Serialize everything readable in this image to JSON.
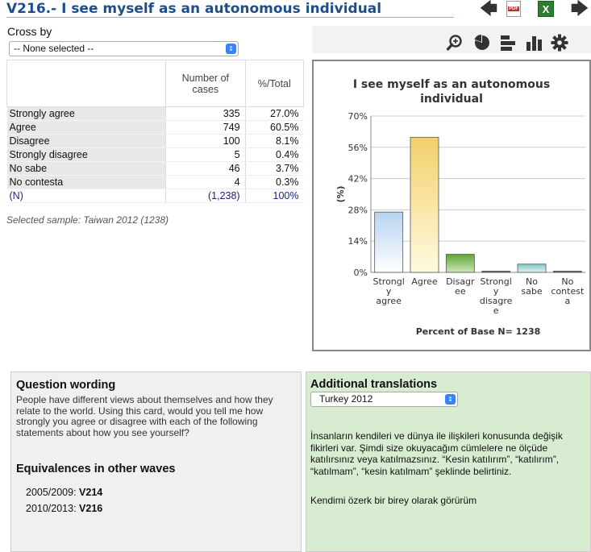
{
  "header": {
    "title": "V216.- I see myself as an autonomous individual"
  },
  "icons": {
    "back": "arrow-left-icon",
    "pdf": "pdf-icon",
    "excel": "excel-icon",
    "forward": "arrow-right-icon",
    "zoom": "zoom-icon",
    "pie": "pie-chart-icon",
    "hbar": "horizontal-bar-icon",
    "vbar": "vertical-bar-icon",
    "settings": "gear-icon"
  },
  "pdf_badge": "PDF",
  "excel_badge": "X",
  "crossby": {
    "label": "Cross by",
    "selected": "-- None selected --"
  },
  "table": {
    "col_cases": "Number of cases",
    "col_total": "%/Total",
    "rows": [
      {
        "label": "Strongly agree",
        "cases": "335",
        "pct": "27.0%"
      },
      {
        "label": "Agree",
        "cases": "749",
        "pct": "60.5%"
      },
      {
        "label": "Disagree",
        "cases": "100",
        "pct": "8.1%"
      },
      {
        "label": "Strongly disagree",
        "cases": "5",
        "pct": "0.4%"
      },
      {
        "label": "No sabe",
        "cases": "46",
        "pct": "3.7%"
      },
      {
        "label": "No contesta",
        "cases": "4",
        "pct": "0.3%"
      }
    ],
    "total": {
      "label": "(N)",
      "cases": "(1,238)",
      "pct": "100%"
    }
  },
  "sample_note": "Selected sample: Taiwan 2012 (1238)",
  "chart_data": {
    "type": "bar",
    "title_lines": [
      "I see myself as an autonomous",
      "individual"
    ],
    "ylabel": "(%)",
    "xlabel": "Percent of Base N= 1238",
    "ylim": [
      0,
      70
    ],
    "yticks": [
      "0%",
      "14%",
      "28%",
      "42%",
      "56%",
      "70%"
    ],
    "categories": [
      [
        "Strongl",
        "y",
        "agree"
      ],
      [
        "Agree"
      ],
      [
        "Disagr",
        "ee"
      ],
      [
        "Strongl",
        "y",
        "disagre",
        "e"
      ],
      [
        "No",
        "sabe"
      ],
      [
        "No",
        "contest",
        "a"
      ]
    ],
    "values": [
      27.0,
      60.5,
      8.1,
      0.4,
      3.7,
      0.3
    ],
    "colors": [
      [
        "#ffffff",
        "#b7d3f0"
      ],
      [
        "#fffbe0",
        "#f3cf6a"
      ],
      [
        "#cde6b4",
        "#5ea63b"
      ],
      [
        "#7a7a7a",
        "#444444"
      ],
      [
        "#e2f3f2",
        "#7ec8c4"
      ],
      [
        "#777777",
        "#444444"
      ]
    ]
  },
  "question": {
    "heading": "Question wording",
    "lines": [
      "People have different views about themselves and how they",
      "relate to the world. Using this card, would you tell me how",
      "strongly you agree or disagree with each of the following",
      "statements about how you see yourself?"
    ]
  },
  "equivalences": {
    "heading": "Equivalences in other waves",
    "items": [
      {
        "wave": "2005/2009:",
        "var": "V214"
      },
      {
        "wave": "2010/2013:",
        "var": "V216"
      }
    ]
  },
  "translations": {
    "heading": "Additional translations",
    "selected": "Turkey 2012",
    "lines": [
      "İnsanların kendileri ve dünya ile ilişkileri konusunda değişik",
      "fikirleri var. Şimdi size okuyacağım cümlelere ne ölçüde",
      "katılırsınız veya katılmazsınız. “Kesin katılırım”, “katılırım”,",
      "“katılmam”, “kesin katılmam” şeklinde belirtiniz."
    ],
    "statement": "Kendimi özerk bir birey olarak görürüm"
  }
}
